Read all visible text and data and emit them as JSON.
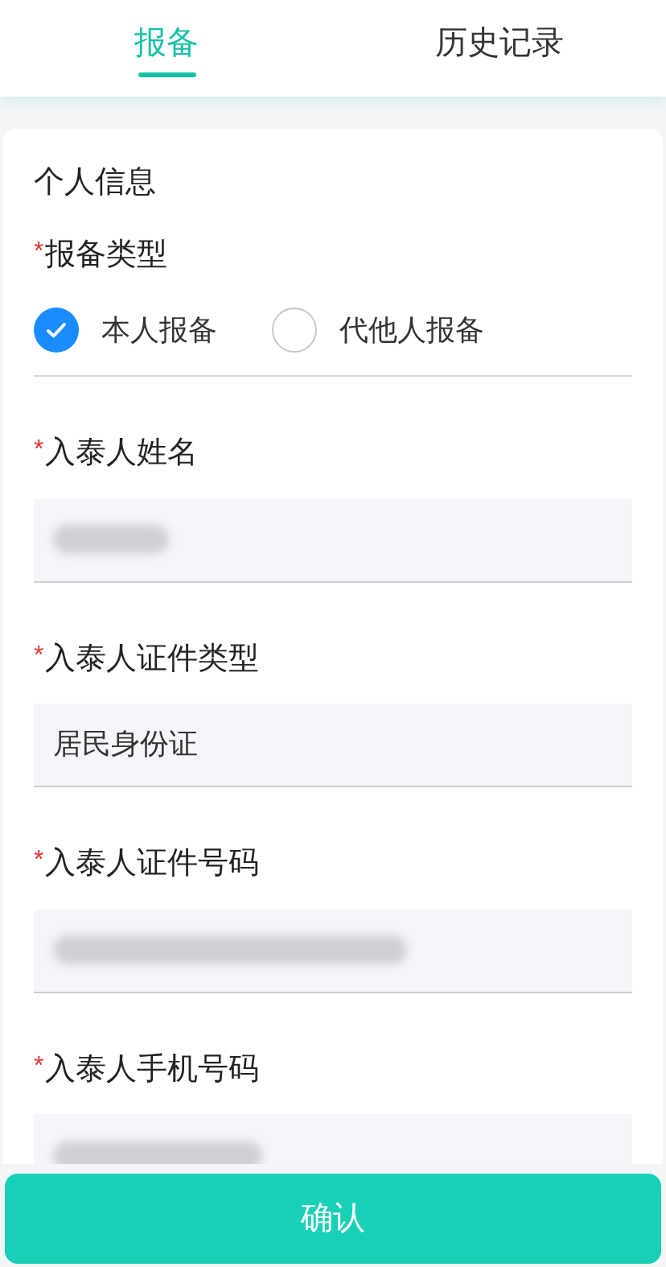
{
  "tabs": [
    {
      "label": "报备",
      "selected": true
    },
    {
      "label": "历史记录",
      "selected": false
    }
  ],
  "section_title": "个人信息",
  "fields": [
    {
      "kind": "radio",
      "label": "报备类型",
      "required_mark": "*",
      "options": [
        {
          "label": "本人报备",
          "selected": true
        },
        {
          "label": "代他人报备",
          "selected": false
        }
      ]
    },
    {
      "kind": "text",
      "label": "入泰人姓名",
      "required_mark": "*",
      "redacted": true
    },
    {
      "kind": "text",
      "label": "入泰人证件类型",
      "required_mark": "*",
      "value": "居民身份证"
    },
    {
      "kind": "text",
      "label": "入泰人证件号码",
      "required_mark": "*",
      "redacted": true
    },
    {
      "kind": "text",
      "label": "入泰人手机号码",
      "required_mark": "*",
      "redacted": true
    }
  ],
  "confirm_button": "确认"
}
